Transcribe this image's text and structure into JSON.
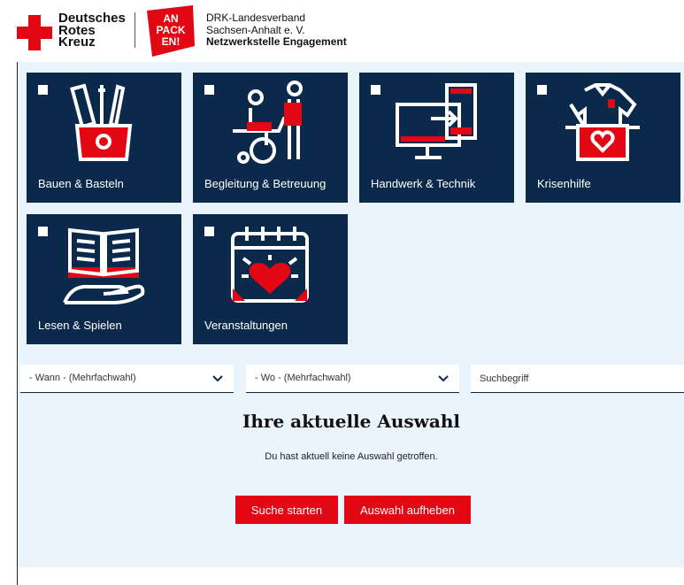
{
  "header": {
    "brand_line1": "Deutsches",
    "brand_line2": "Rotes",
    "brand_line3": "Kreuz",
    "logo_line1": "AN",
    "logo_line2": "PACK",
    "logo_line3": "EN!",
    "org_line1": "DRK-Landesverband",
    "org_line2": "Sachsen-Anhalt e. V.",
    "org_line3": "Netzwerkstelle Engagement"
  },
  "categories": [
    {
      "label": "Bauen & Basteln",
      "icon": "craft-tools-icon"
    },
    {
      "label": "Begleitung & Betreuung",
      "icon": "wheelchair-companion-icon"
    },
    {
      "label": "Handwerk & Technik",
      "icon": "monitor-phone-icon"
    },
    {
      "label": "Krisenhilfe",
      "icon": "clothing-donation-box-icon"
    },
    {
      "label": "Lesen & Spielen",
      "icon": "book-hand-icon"
    },
    {
      "label": "Veranstaltungen",
      "icon": "calendar-heart-icon"
    }
  ],
  "filters": {
    "when": "- Wann - (Mehrfachwahl)",
    "where": "- Wo - (Mehrfachwahl)",
    "search_placeholder": "Suchbegriff"
  },
  "selection": {
    "title": "Ihre aktuelle Auswahl",
    "text": "Du hast aktuell keine Auswahl getroffen."
  },
  "buttons": {
    "search": "Suche starten",
    "clear": "Auswahl aufheben"
  },
  "colors": {
    "navy": "#0b2a4b",
    "red": "#e30613",
    "panel": "#eaf4fc"
  }
}
